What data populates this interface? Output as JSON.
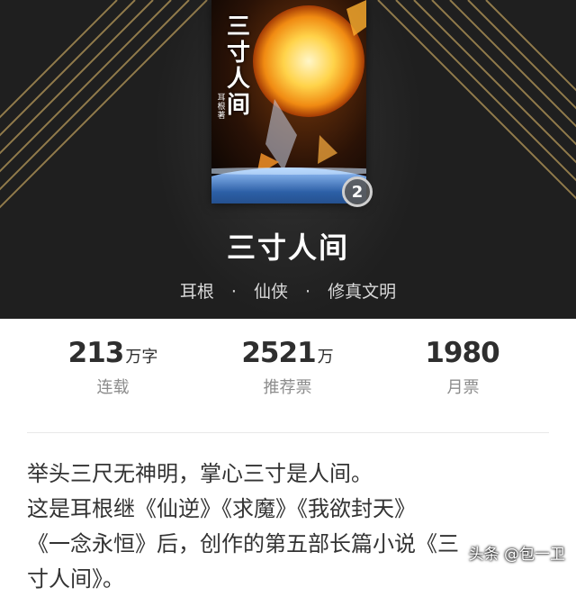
{
  "book": {
    "title": "三寸人间",
    "author": "耳根",
    "category": "仙侠",
    "subcategory": "修真文明",
    "separator": "·",
    "cover_title_chars": [
      "三",
      "寸",
      "人",
      "间"
    ],
    "cover_author_text": "耳根著",
    "volume_badge": "2"
  },
  "stats": [
    {
      "value": "213",
      "unit": "万字",
      "label": "连载"
    },
    {
      "value": "2521",
      "unit": "万",
      "label": "推荐票"
    },
    {
      "value": "1980",
      "unit": "",
      "label": "月票"
    }
  ],
  "description": [
    "举头三尺无神明，掌心三寸是人间。",
    "这是耳根继《仙逆》《求魔》《我欲封天》",
    "《一念永恒》后，创作的第五部长篇小说《三",
    "寸人间》。"
  ],
  "watermark": "头条 @包一卫",
  "colors": {
    "header_bg": "#1f1f1f",
    "stripe_gold": "#b89a5a",
    "text_dark": "#2e2e2e",
    "text_muted": "#8c8c8c"
  }
}
